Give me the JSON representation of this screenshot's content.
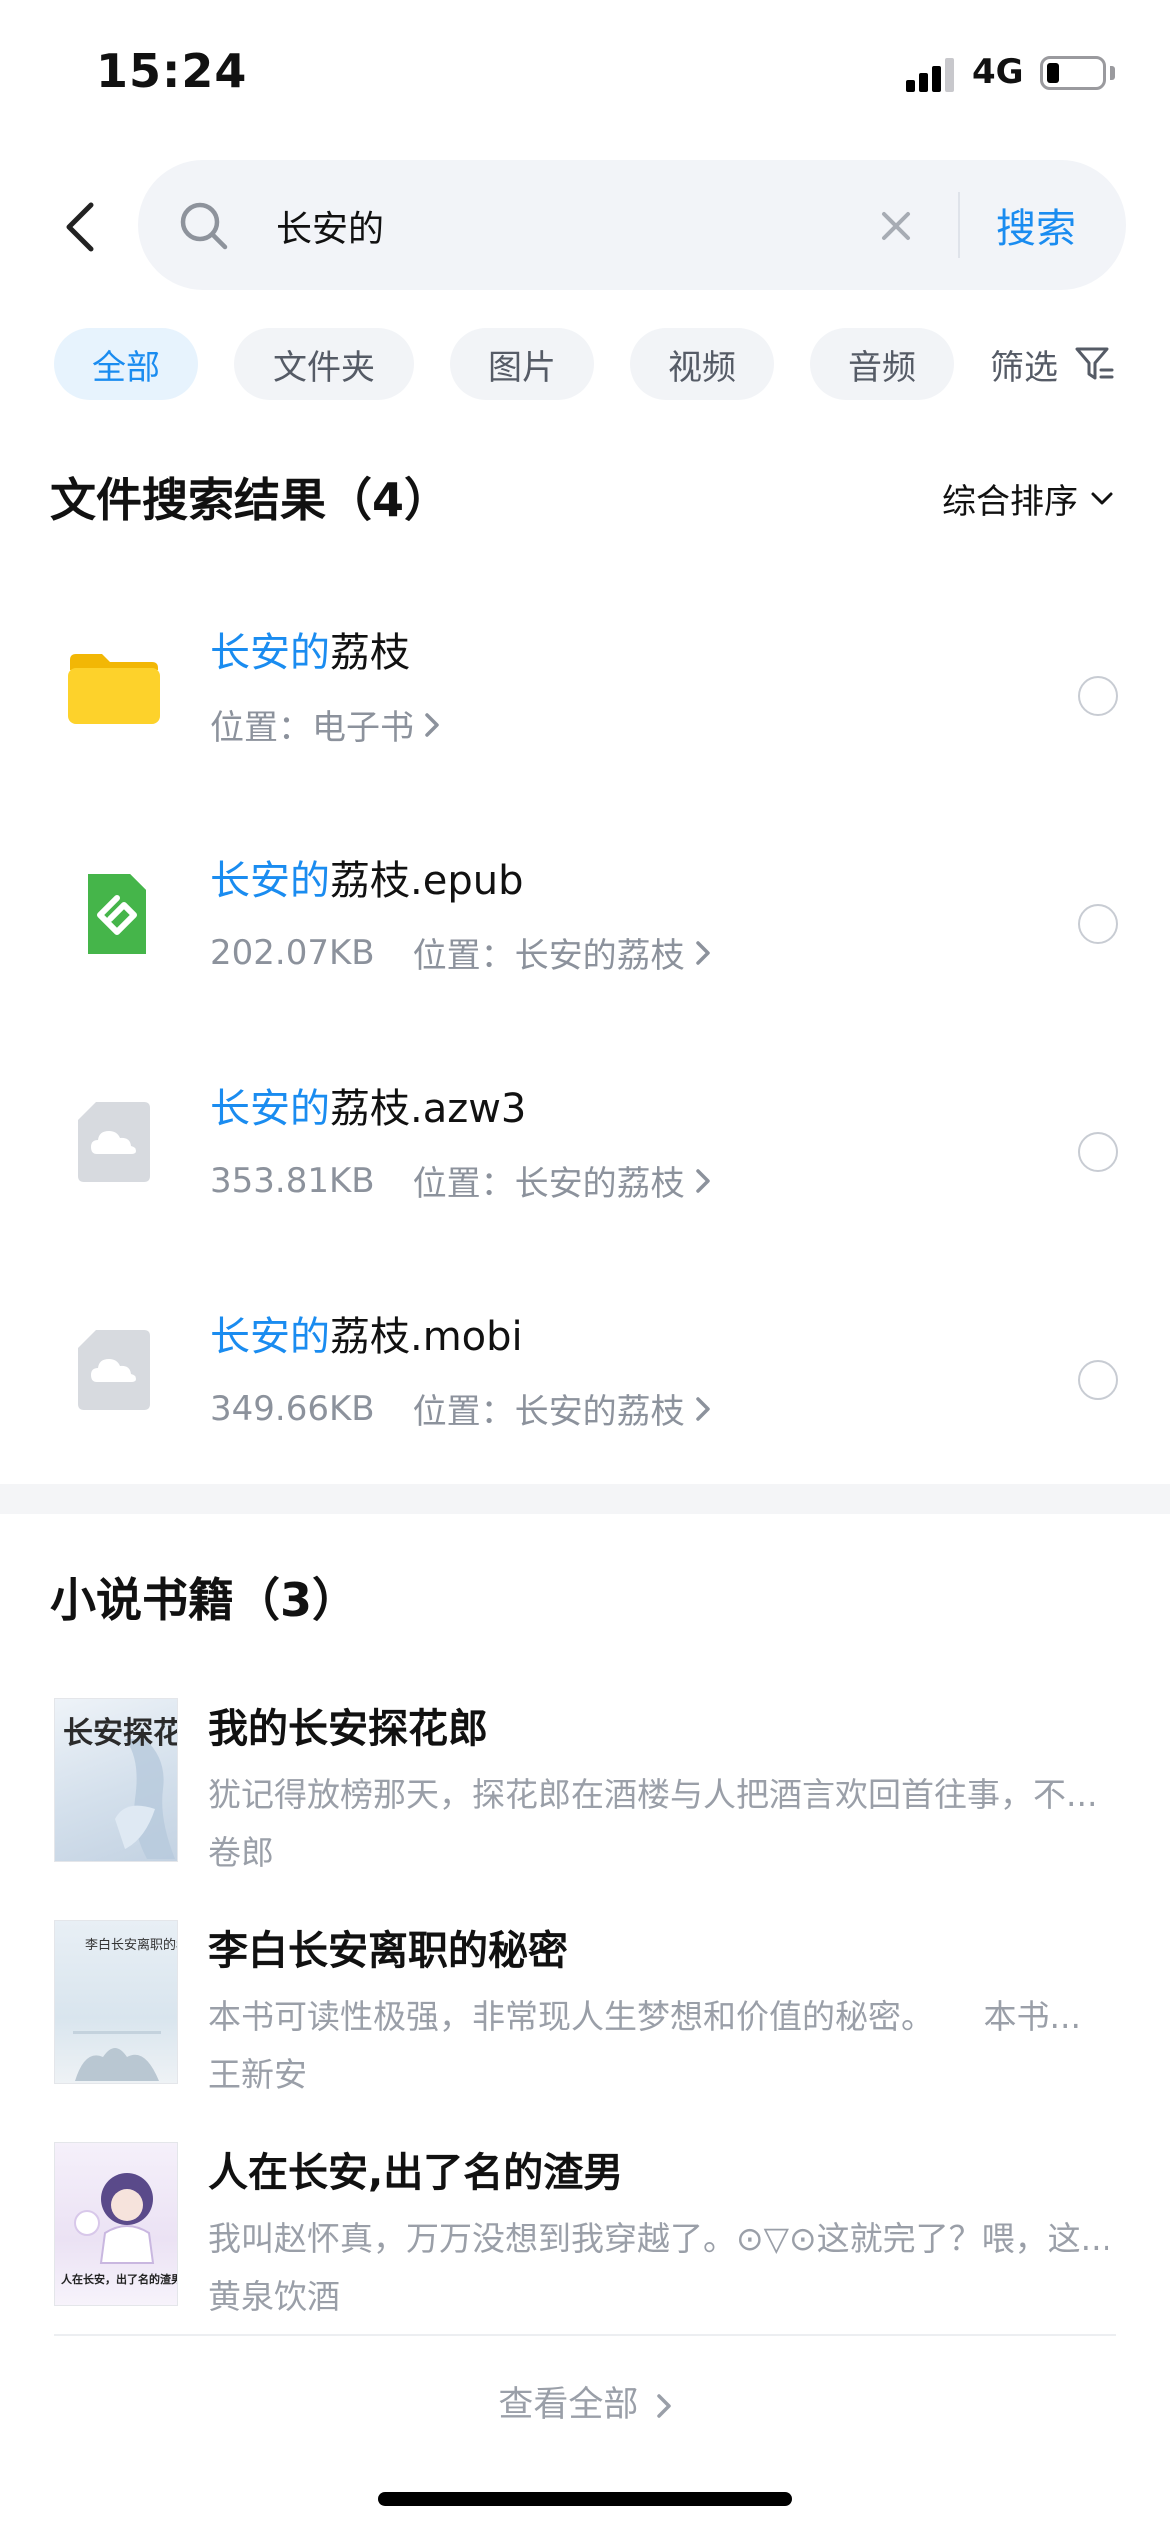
{
  "status_bar": {
    "time": "15:24",
    "network": "4G"
  },
  "search": {
    "query": "长安的",
    "button_label": "搜索"
  },
  "filters": {
    "chips": [
      "全部",
      "文件夹",
      "图片",
      "视频",
      "音频"
    ],
    "active_index": 0,
    "filter_label": "筛选"
  },
  "files_section": {
    "title": "文件搜索结果（4）",
    "sort_label": "综合排序",
    "items": [
      {
        "highlight": "长安的",
        "rest": "荔枝",
        "size": "",
        "location": "位置：电子书",
        "icon": "folder-icon"
      },
      {
        "highlight": "长安的",
        "rest": "荔枝.epub",
        "size": "202.07KB",
        "location": "位置：长安的荔枝",
        "icon": "epub-icon"
      },
      {
        "highlight": "长安的",
        "rest": "荔枝.azw3",
        "size": "353.81KB",
        "location": "位置：长安的荔枝",
        "icon": "cloud-file-icon"
      },
      {
        "highlight": "长安的",
        "rest": "荔枝.mobi",
        "size": "349.66KB",
        "location": "位置：长安的荔枝",
        "icon": "cloud-file-icon"
      }
    ]
  },
  "books_section": {
    "title": "小说书籍（3）",
    "items": [
      {
        "title": "我的长安探花郎",
        "desc": "犹记得放榜那天，探花郎在酒楼与人把酒言欢回首往事，不...",
        "author": "卷郎",
        "cover_text": "长安探花郎",
        "cover_color": "#dfe8f2"
      },
      {
        "title": "李白长安离职的秘密",
        "desc": "本书可读性极强，非常现人生梦想和价值的秘密。　　本书...",
        "author": "王新安",
        "cover_text": "李白长安离职的秘密",
        "cover_color": "#e3ecf3"
      },
      {
        "title": "人在长安,出了名的渣男",
        "desc": "我叫赵怀真，万万没想到我穿越了。⊙▽⊙这就完了？喂，这...",
        "author": "黄泉饮酒",
        "cover_text": "人在长安，出了名的渣男",
        "cover_color": "#eee6f5"
      }
    ]
  },
  "view_all_label": "查看全部",
  "colors": {
    "accent": "#1a8cf0",
    "muted": "#8c929c"
  }
}
